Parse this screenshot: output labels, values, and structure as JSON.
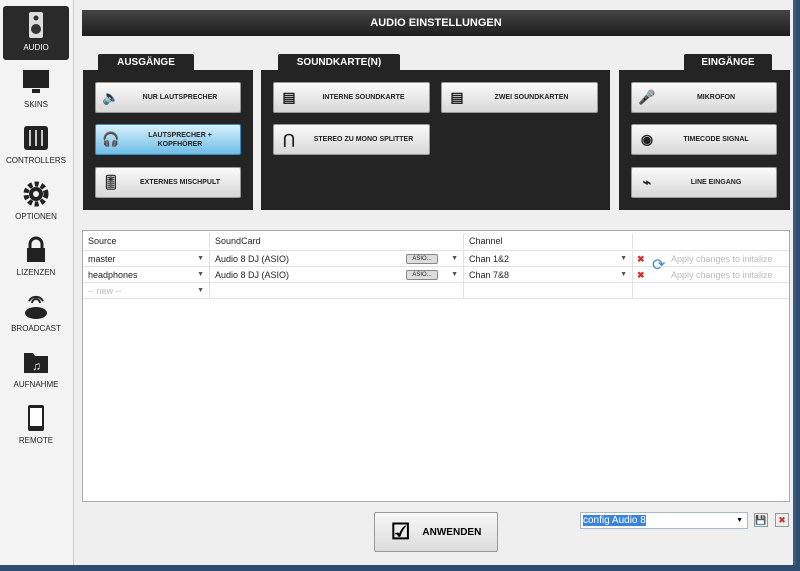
{
  "sidebar": {
    "items": [
      {
        "label": "AUDIO",
        "icon": "speaker-icon"
      },
      {
        "label": "SKINS",
        "icon": "monitor-icon"
      },
      {
        "label": "CONTROLLERS",
        "icon": "mixer-icon"
      },
      {
        "label": "OPTIONEN",
        "icon": "gear-icon"
      },
      {
        "label": "LIZENZEN",
        "icon": "lock-icon"
      },
      {
        "label": "BROADCAST",
        "icon": "broadcast-icon"
      },
      {
        "label": "AUFNAHME",
        "icon": "music-folder-icon"
      },
      {
        "label": "REMOTE",
        "icon": "tablet-icon"
      }
    ]
  },
  "title": "AUDIO EINSTELLUNGEN",
  "outputs": {
    "tab": "AUSGÄNGE",
    "buttons": [
      "NUR LAUTSPRECHER",
      "LAUTSPRECHER + KOPFHÖRER",
      "EXTERNES MISCHPULT"
    ]
  },
  "soundcards": {
    "tab": "SOUNDKARTE(N)",
    "buttons": [
      "INTERNE SOUNDKARTE",
      "ZWEI SOUNDKARTEN",
      "STEREO ZU MONO SPLITTER"
    ]
  },
  "inputs": {
    "tab": "EINGÄNGE",
    "buttons": [
      "MIKROFON",
      "TIMECODE SIGNAL",
      "LINE EINGANG"
    ]
  },
  "table": {
    "headers": [
      "Source",
      "SoundCard",
      "Channel"
    ],
    "rows": [
      {
        "source": "master",
        "card": "Audio 8 DJ (ASIO)",
        "asio": "ASIO...",
        "channel": "Chan 1&2",
        "status": "Apply changes to initalize"
      },
      {
        "source": "headphones",
        "card": "Audio 8 DJ (ASIO)",
        "asio": "ASIO...",
        "channel": "Chan 7&8",
        "status": "Apply changes to initalize"
      }
    ],
    "new_row": "-- new --"
  },
  "apply_label": "ANWENDEN",
  "config": {
    "value": "config Audio 8"
  }
}
